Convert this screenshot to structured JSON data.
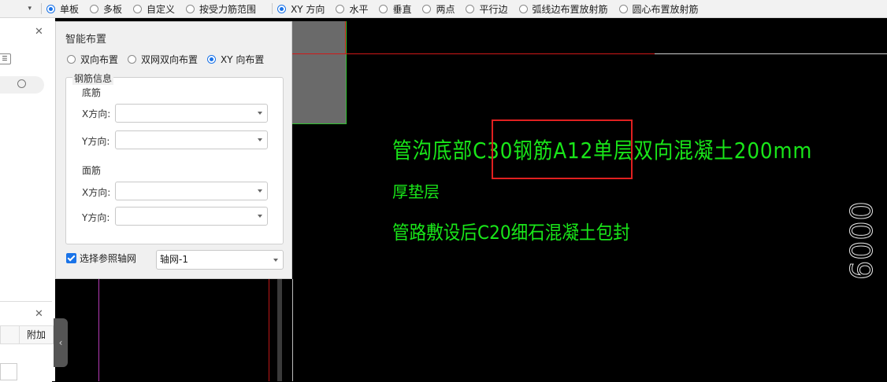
{
  "toolbar": {
    "options": [
      {
        "label": "单板",
        "checked": true
      },
      {
        "label": "多板",
        "checked": false
      },
      {
        "label": "自定义",
        "checked": false
      },
      {
        "label": "按受力筋范围",
        "checked": false
      }
    ],
    "direction_options": [
      {
        "label": "XY 方向",
        "checked": true
      },
      {
        "label": "水平",
        "checked": false
      },
      {
        "label": "垂直",
        "checked": false
      },
      {
        "label": "两点",
        "checked": false
      },
      {
        "label": "平行边",
        "checked": false
      },
      {
        "label": "弧线边布置放射筋",
        "checked": false
      },
      {
        "label": "圆心布置放射筋",
        "checked": false
      }
    ]
  },
  "left_panel": {
    "column_header": "附加"
  },
  "dialog": {
    "title": "智能布置",
    "modes": [
      {
        "label": "双向布置",
        "checked": false
      },
      {
        "label": "双网双向布置",
        "checked": false
      },
      {
        "label": "XY 向布置",
        "checked": true
      }
    ],
    "group_title": "钢筋信息",
    "bottom_section": "底筋",
    "top_section": "面筋",
    "x_label": "X方向:",
    "y_label": "Y方向:",
    "bottom_x_value": "",
    "bottom_y_value": "",
    "top_x_value": "",
    "top_y_value": "",
    "ref_grid_label": "选择参照轴网",
    "ref_grid_checked": true,
    "ref_grid_value": "轴网-1"
  },
  "canvas": {
    "line1": "管沟底部C30钢筋A12单层双向混凝土200mm",
    "line2": "厚垫层",
    "line3": "管路敷设后C20细石混凝土包封",
    "dimension": "6000",
    "colors": {
      "text": "#19e619",
      "highlight": "#e02020",
      "background": "#000000"
    }
  }
}
